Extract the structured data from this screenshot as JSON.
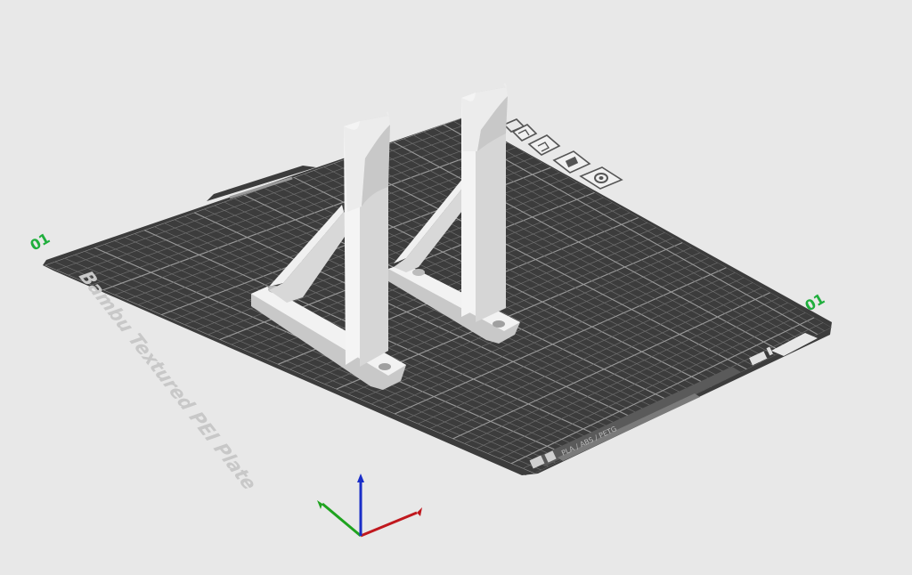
{
  "plate": {
    "label": "Bambu Textured PEI Plate",
    "corner_label_left": "01",
    "corner_label_right": "01",
    "bottom_tag": "PLA / ABS / PETG"
  },
  "colors": {
    "background": "#e8e8e8",
    "plate": "#3c3c3c",
    "grid": "#8a8a8a",
    "model": "#e2e2e2",
    "axis_x": "#c0181e",
    "axis_y": "#1fa31f",
    "axis_z": "#1a2ec8",
    "corner_label": "#1fae3c"
  },
  "plate_toolbar": {
    "icons": [
      "arrange-icon",
      "orient-icon",
      "plate-settings-icon",
      "lock-icon",
      "settings-gear-icon"
    ]
  },
  "axes": [
    "x-axis",
    "y-axis",
    "z-axis"
  ]
}
